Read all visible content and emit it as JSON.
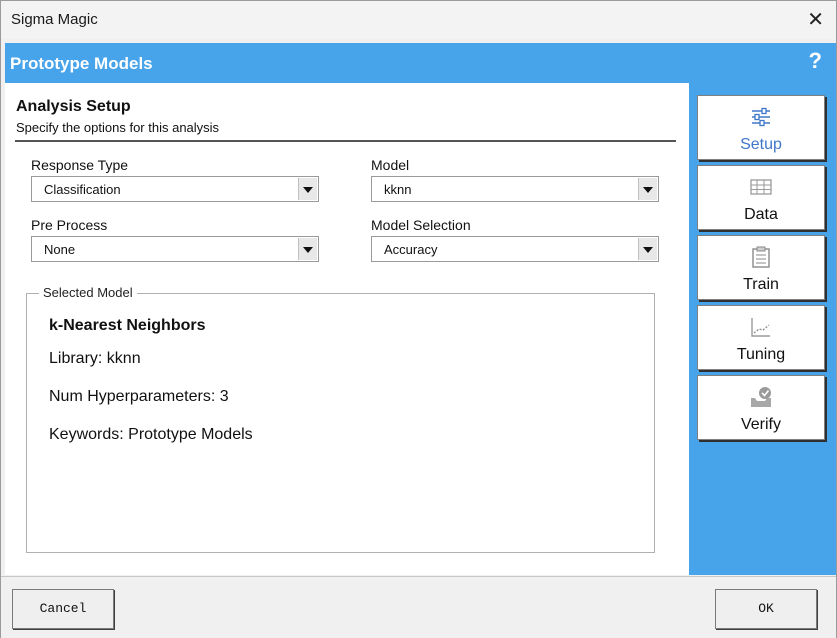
{
  "window": {
    "title": "Sigma Magic",
    "close_glyph": "✕"
  },
  "header": {
    "title": "Prototype Models",
    "help_glyph": "?"
  },
  "section": {
    "title": "Analysis Setup",
    "subtitle": "Specify the options for this analysis"
  },
  "fields": {
    "response_type": {
      "label": "Response Type",
      "value": "Classification"
    },
    "model": {
      "label": "Model",
      "value": "kknn"
    },
    "pre_process": {
      "label": "Pre Process",
      "value": "None"
    },
    "model_selection": {
      "label": "Model Selection",
      "value": "Accuracy"
    }
  },
  "selected_model": {
    "legend": "Selected Model",
    "name": "k-Nearest Neighbors",
    "library": "Library: kknn",
    "num_hyperparameters": "Num Hyperparameters: 3",
    "keywords": "Keywords: Prototype Models"
  },
  "nav": [
    {
      "label": "Setup",
      "icon": "sliders-icon",
      "active": true
    },
    {
      "label": "Data",
      "icon": "table-icon",
      "active": false
    },
    {
      "label": "Train",
      "icon": "clipboard-icon",
      "active": false
    },
    {
      "label": "Tuning",
      "icon": "line-chart-icon",
      "active": false
    },
    {
      "label": "Verify",
      "icon": "verify-inbox-icon",
      "active": false
    }
  ],
  "footer": {
    "cancel_label": "Cancel",
    "ok_label": "OK"
  },
  "colors": {
    "accent": "#47a3ea",
    "active_text": "#3f77c9"
  }
}
